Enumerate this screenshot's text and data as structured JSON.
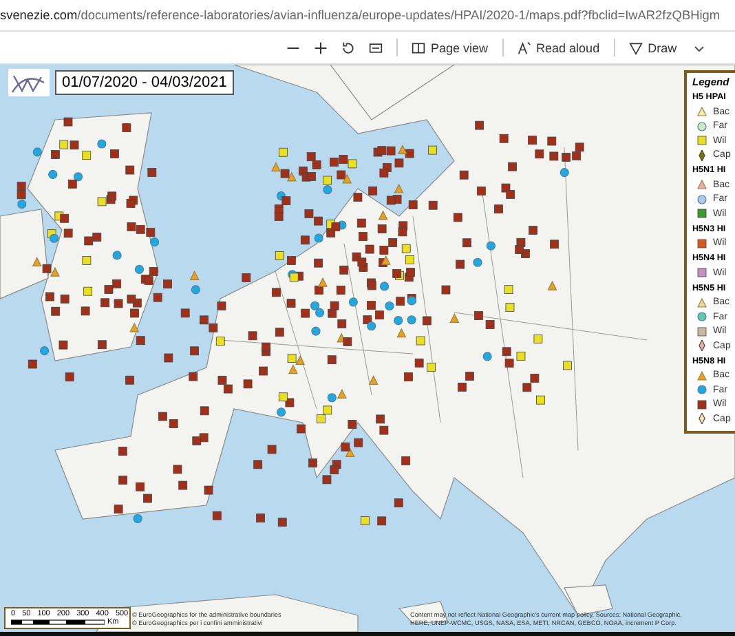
{
  "address_bar": {
    "host": "svenezie.com",
    "path": "/documents/reference-laboratories/avian-influenza/europe-updates/HPAI/2020-1/maps.pdf?fbclid=IwAR2fzQBHigm"
  },
  "toolbar": {
    "page_view": "Page view",
    "read_aloud": "Read aloud",
    "draw": "Draw"
  },
  "map": {
    "date_range": "01/07/2020 - 04/03/2021",
    "legend": {
      "title": "Legend",
      "groups": [
        {
          "title": "H5 HPAI",
          "entries": [
            {
              "label": "Bac",
              "kind": "triangle",
              "color": "#f2eeb0"
            },
            {
              "label": "Far",
              "kind": "circle",
              "color": "#cfe8c0"
            },
            {
              "label": "Wil",
              "kind": "square",
              "color": "#e8e020"
            },
            {
              "label": "Cap",
              "kind": "diamond",
              "color": "#6b7a1a"
            }
          ]
        },
        {
          "title": "H5N1 HI",
          "entries": [
            {
              "label": "Bac",
              "kind": "triangle",
              "color": "#e8b0b0"
            },
            {
              "label": "Far",
              "kind": "circle",
              "color": "#b0c8e8"
            },
            {
              "label": "Wil",
              "kind": "square",
              "color": "#3a9a2a"
            }
          ]
        },
        {
          "title": "H5N3 HI",
          "entries": [
            {
              "label": "Wil",
              "kind": "square",
              "color": "#d85a20"
            }
          ]
        },
        {
          "title": "H5N4 HI",
          "entries": [
            {
              "label": "Wil",
              "kind": "square",
              "color": "#c890c0"
            }
          ]
        },
        {
          "title": "H5N5 HI",
          "entries": [
            {
              "label": "Bac",
              "kind": "triangle",
              "color": "#e8d8a0"
            },
            {
              "label": "Far",
              "kind": "circle",
              "color": "#60c8b0"
            },
            {
              "label": "Wil",
              "kind": "square",
              "color": "#c8b8a0"
            },
            {
              "label": "Cap",
              "kind": "diamond",
              "color": "#e0b0c0"
            }
          ]
        },
        {
          "title": "H5N8 HI",
          "entries": [
            {
              "label": "Bac",
              "kind": "triangle",
              "color": "#e8a020"
            },
            {
              "label": "Far",
              "kind": "circle",
              "color": "#20a8e0"
            },
            {
              "label": "Wil",
              "kind": "square",
              "color": "#a0301a"
            },
            {
              "label": "Cap",
              "kind": "diamond",
              "color": "#f0e8c8"
            }
          ]
        }
      ]
    },
    "scale": {
      "ticks": [
        "0",
        "50",
        "100",
        "200",
        "300",
        "400",
        "500"
      ],
      "unit": "Km"
    },
    "credits_left": [
      "© EuroGeographics for the administrative boundaries",
      "© EuroGeographics per i confini amministrativi"
    ],
    "credits_right": [
      "Content may not reflect National Geographic's current map policy. Sources: National Geographic,",
      "HERE, UNEP-WCMC, USGS, NASA, ESA, METI, NRCAN, GEBCO, NOAA, increment P Corp."
    ]
  }
}
